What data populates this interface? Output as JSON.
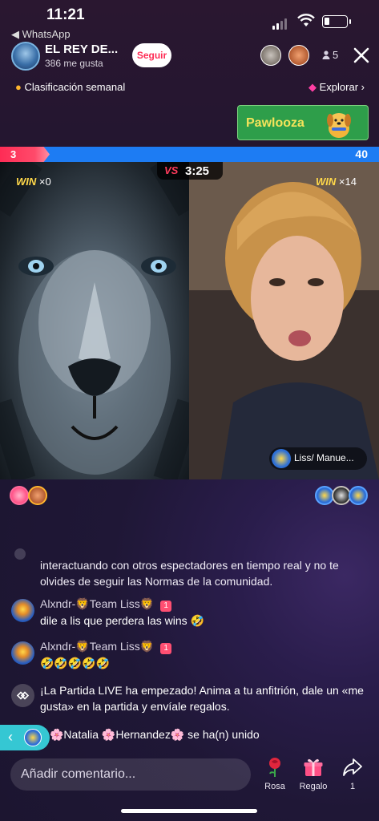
{
  "status_bar": {
    "time": "11:21",
    "back_app": "◀ WhatsApp"
  },
  "host": {
    "name": "EL REY DE...",
    "likes": "386 me gusta",
    "follow_label": "Seguir"
  },
  "viewers": {
    "count": "5"
  },
  "ranking_label": "Clasificación semanal",
  "explore_label": "Explorar",
  "banner": {
    "label": "Pawlooza"
  },
  "battle": {
    "score_left": "3",
    "score_right": "40",
    "vs": "VS",
    "timer": "3:25",
    "left_win": "WIN",
    "left_mult": "×0",
    "right_win": "WIN",
    "right_mult": "×14",
    "guest_name": "Liss/ Manue..."
  },
  "chat": {
    "system_note": "interactuando con otros espectadores en tiempo real y no te olvides de seguir las Normas de la comunidad.",
    "messages": [
      {
        "user": "Alxndr-🦁Team Liss🦁",
        "badge": "1",
        "text": "dile a lis que perdera las wins 🤣"
      },
      {
        "user": "Alxndr-🦁Team Liss🦁",
        "badge": "1",
        "text": "🤣🤣🤣🤣🤣"
      }
    ],
    "live_notice": "¡La Partida LIVE ha empezado! Anima a tu anfitrión, dale un «me gusta» en la partida y envíale regalos.",
    "join_notice": "🌸Natalia 🌸Hernandez🌸 se ha(n) unido"
  },
  "bottom": {
    "comment_placeholder": "Añadir comentario...",
    "rose_label": "Rosa",
    "gift_label": "Regalo",
    "share_count": "1"
  },
  "colors": {
    "accent_red": "#fe2c55",
    "accent_blue": "#1d7cf3",
    "win_yellow": "#ffd84a",
    "join_cyan": "#35c7d3"
  }
}
